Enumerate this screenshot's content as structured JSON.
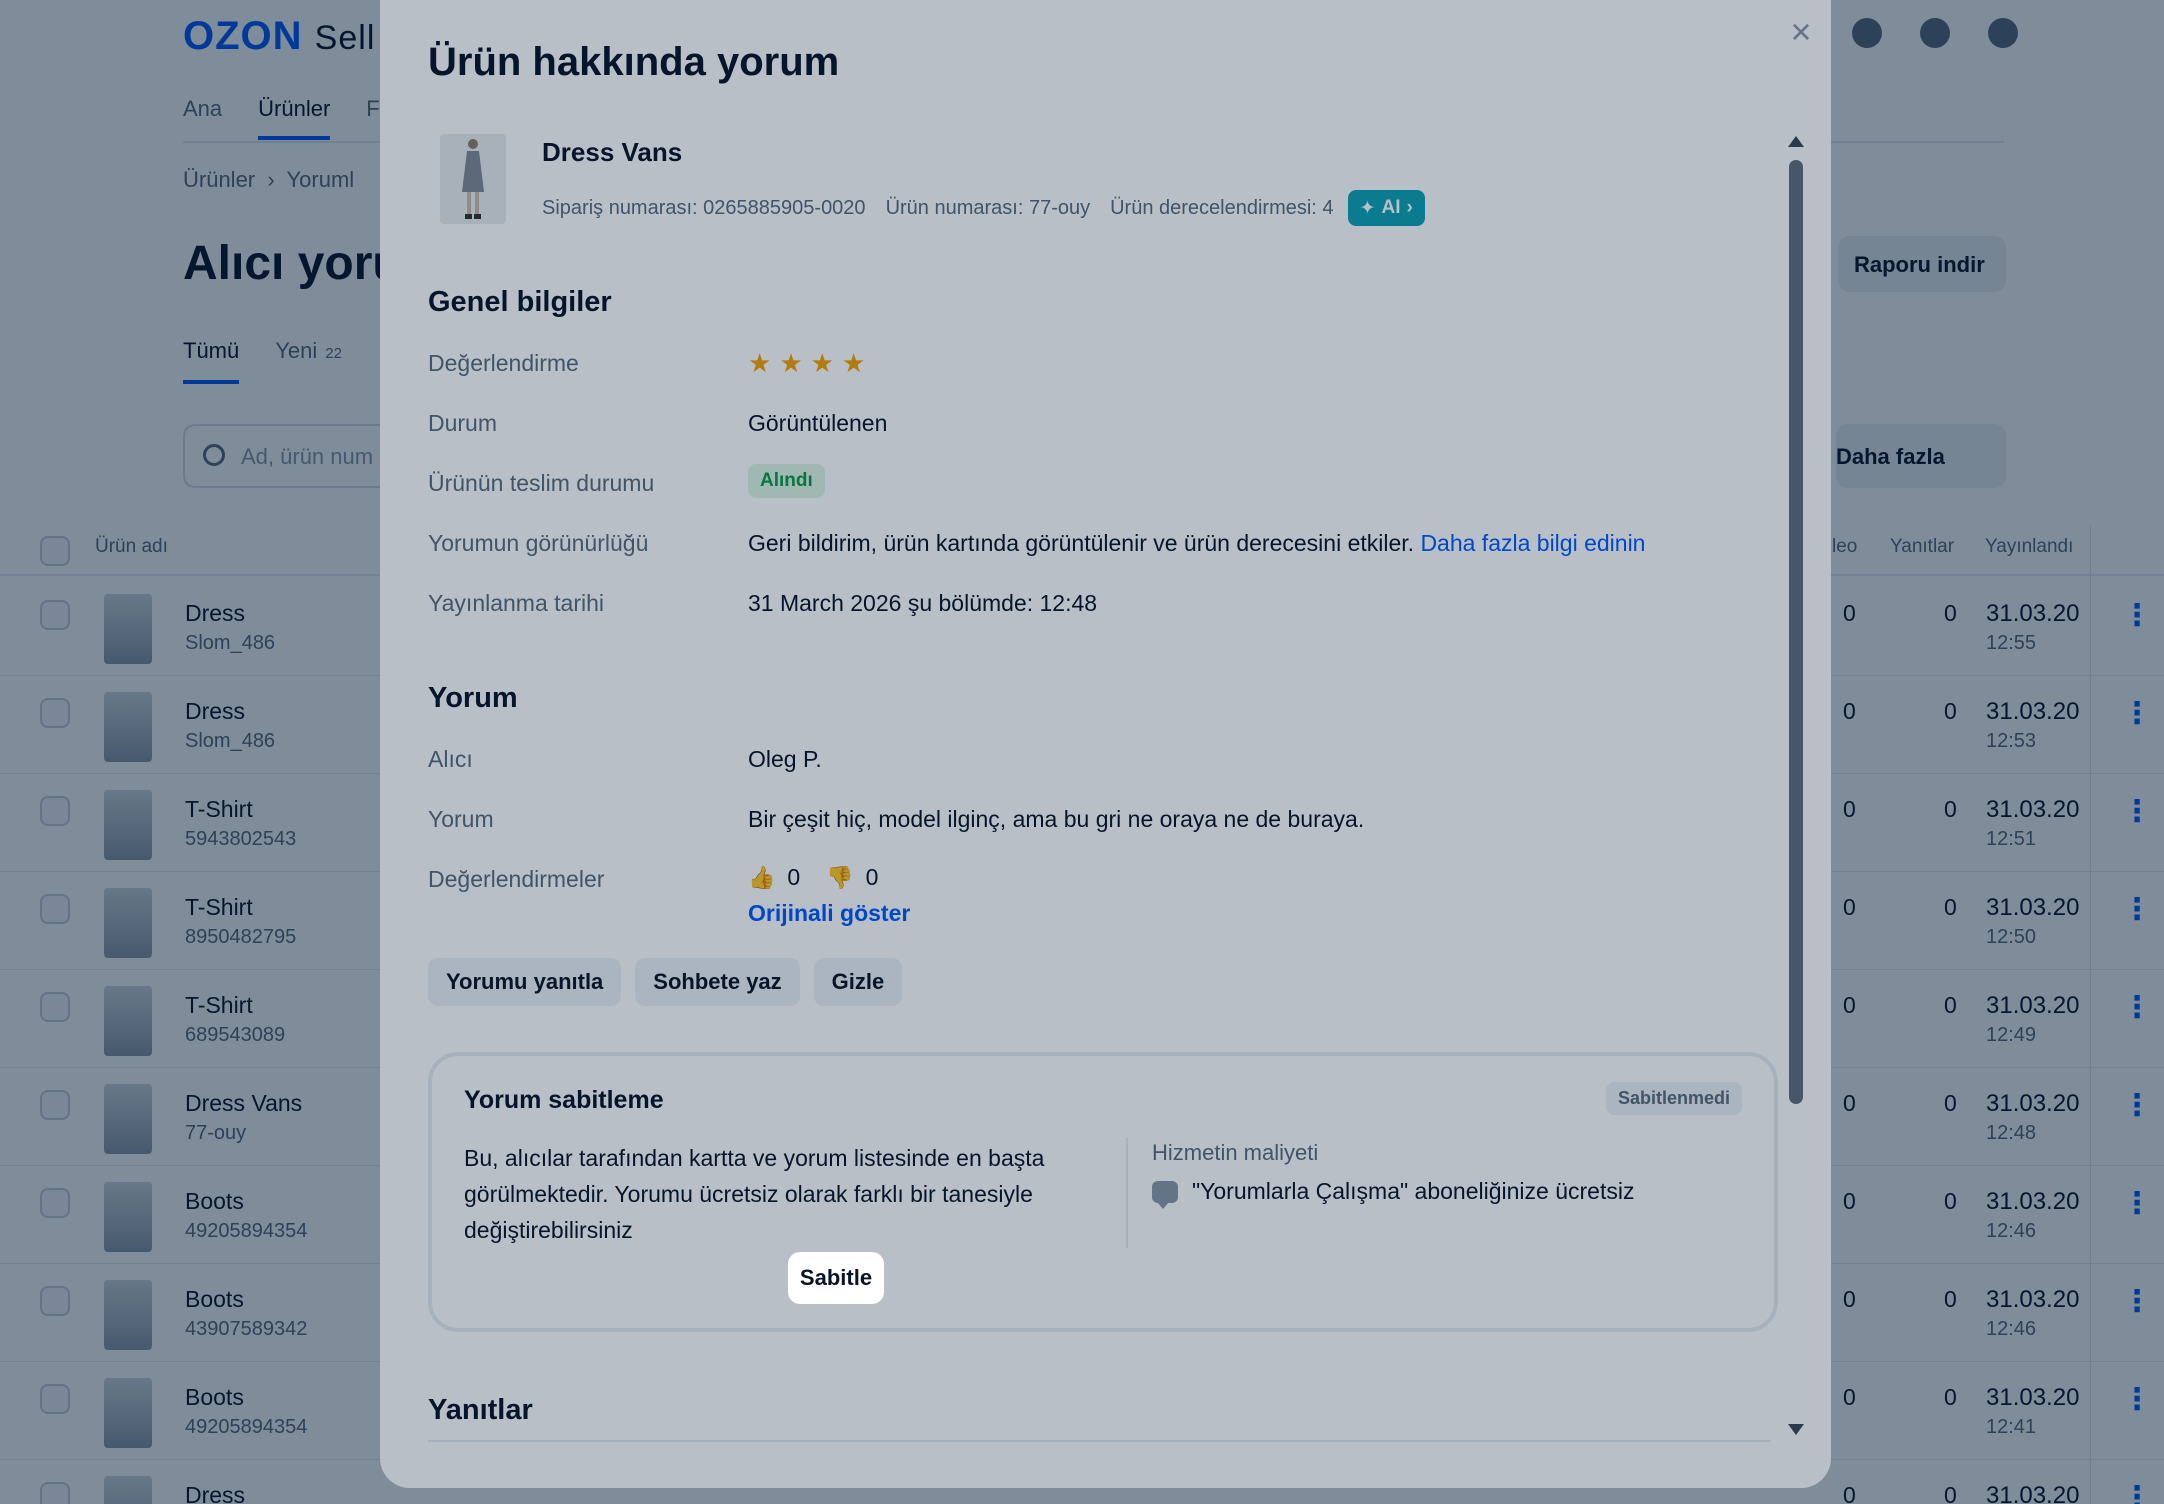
{
  "background": {
    "logo": "OZON",
    "logo_suffix": "Sell",
    "nav": [
      "Ana",
      "Ürünler",
      "F"
    ],
    "breadcrumb": [
      "Ürünler",
      "Yoruml"
    ],
    "page_title": "Alıcı yoru",
    "tabs": [
      {
        "label": "Tümü"
      },
      {
        "label": "Yeni",
        "count": "22"
      }
    ],
    "search_placeholder": "Ad, ürün num",
    "download_button": "Raporu indir",
    "more_button": "Daha fazla",
    "columns": {
      "name": "Ürün adı",
      "video": "leo",
      "answers": "Yanıtlar",
      "published": "Yayınlandı"
    },
    "rows": [
      {
        "name": "Dress",
        "sku": "Slom_486",
        "video": "0",
        "answers": "0",
        "date": "31.03.20",
        "time": "12:55"
      },
      {
        "name": "Dress",
        "sku": "Slom_486",
        "video": "0",
        "answers": "0",
        "date": "31.03.20",
        "time": "12:53"
      },
      {
        "name": "T-Shirt",
        "sku": "5943802543",
        "video": "0",
        "answers": "0",
        "date": "31.03.20",
        "time": "12:51"
      },
      {
        "name": "T-Shirt",
        "sku": "8950482795",
        "video": "0",
        "answers": "0",
        "date": "31.03.20",
        "time": "12:50"
      },
      {
        "name": "T-Shirt",
        "sku": "689543089",
        "video": "0",
        "answers": "0",
        "date": "31.03.20",
        "time": "12:49"
      },
      {
        "name": "Dress Vans",
        "sku": "77-ouy",
        "video": "0",
        "answers": "0",
        "date": "31.03.20",
        "time": "12:48"
      },
      {
        "name": "Boots",
        "sku": "49205894354",
        "video": "0",
        "answers": "0",
        "date": "31.03.20",
        "time": "12:46"
      },
      {
        "name": "Boots",
        "sku": "43907589342",
        "video": "0",
        "answers": "0",
        "date": "31.03.20",
        "time": "12:46"
      },
      {
        "name": "Boots",
        "sku": "49205894354",
        "video": "0",
        "answers": "0",
        "date": "31.03.20",
        "time": "12:41"
      },
      {
        "name": "Dress",
        "sku": "",
        "video": "0",
        "answers": "0",
        "date": "31.03.20",
        "time": ""
      }
    ]
  },
  "modal": {
    "title": "Ürün hakkında yorum",
    "close_icon": "close-icon",
    "product": {
      "name": "Dress Vans",
      "order_number": "Sipariş numarası: 0265885905-0020",
      "product_number": "Ürün numarası: 77-ouy",
      "product_rating": "Ürün derecelendirmesi: 4",
      "ai_chip": "AI"
    },
    "general": {
      "title": "Genel bilgiler",
      "rating_label": "Değerlendirme",
      "rating_value": 4,
      "status_label": "Durum",
      "status_value": "Görüntülenen",
      "delivery_label": "Ürünün teslim durumu",
      "delivery_value": "Alındı",
      "visibility_label": "Yorumun görünürlüğü",
      "visibility_text": "Geri bildirim, ürün kartında görüntülenir ve ürün derecesini etkiler.",
      "visibility_link": "Daha fazla bilgi edinin",
      "published_label": "Yayınlanma tarihi",
      "published_value": "31 March 2026 şu bölümde: 12:48"
    },
    "review": {
      "title": "Yorum",
      "buyer_label": "Alıcı",
      "buyer_value": "Oleg P.",
      "comment_label": "Yorum",
      "comment_value": "Bir çeşit hiç, model ilginç, ama bu gri ne oraya ne de buraya.",
      "votes_label": "Değerlendirmeler",
      "likes": "0",
      "dislikes": "0",
      "show_original": "Orijinali göster"
    },
    "actions": [
      "Yorumu yanıtla",
      "Sohbete yaz",
      "Gizle"
    ],
    "pinning": {
      "title": "Yorum sabitleme",
      "status": "Sabitlenmedi",
      "description": "Bu, alıcılar tarafından kartta ve yorum listesinde en başta görülmektedir. Yorumu ücretsiz olarak farklı bir tanesiyle değiştirebilirsiniz",
      "cost_label": "Hizmetin maliyeti",
      "cost_value": "\"Yorumlarla Çalışma\" aboneliğinize ücretsiz",
      "pin_button": "Sabitle"
    },
    "answers_title": "Yanıtlar"
  },
  "colors": {
    "accent": "#005bff",
    "ai_chip": "#10a3b5",
    "star": "#f5a300",
    "badge_green": "#0b9a48"
  }
}
